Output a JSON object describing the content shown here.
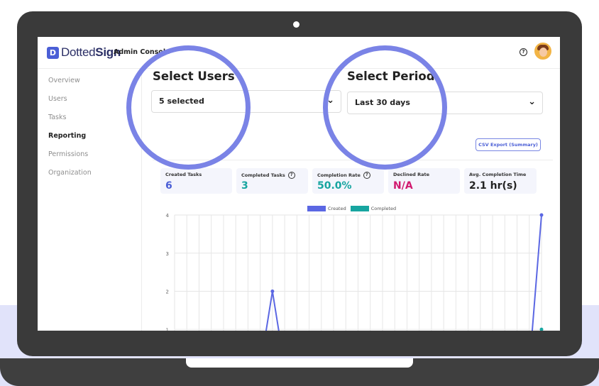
{
  "app": {
    "logo_mark": "D",
    "logo_text_light": "Dotted",
    "logo_text_bold": "Sign",
    "console_title": "Admin Console",
    "help_icon": "question-circle-icon",
    "avatar_icon": "user-avatar"
  },
  "sidebar": {
    "items": [
      {
        "label": "Overview",
        "active": false
      },
      {
        "label": "Users",
        "active": false
      },
      {
        "label": "Tasks",
        "active": false
      },
      {
        "label": "Reporting",
        "active": true
      },
      {
        "label": "Permissions",
        "active": false
      },
      {
        "label": "Organization",
        "active": false
      }
    ]
  },
  "filters": {
    "users_label": "Select Users",
    "users_value": "5 selected",
    "period_label": "Select Period",
    "period_value": "Last 30 days",
    "chevron_icon": "chevron-down-icon"
  },
  "csv_export_label": "CSV Export (Summary)",
  "stats": [
    {
      "label": "Created Tasks",
      "value": "6",
      "help": false,
      "color": "#4b5fd6"
    },
    {
      "label": "Completed Tasks",
      "value": "3",
      "help": true,
      "color": "#17a5a0"
    },
    {
      "label": "Completion Rate",
      "value": "50.0%",
      "help": true,
      "color": "#17a5a0"
    },
    {
      "label": "Declined Rate",
      "value": "N/A",
      "help": false,
      "color": "#d11a6f"
    },
    {
      "label": "Avg. Completion Time",
      "value": "2.1 hr(s)",
      "help": false,
      "color": "#222222"
    }
  ],
  "chart_data": {
    "type": "line",
    "yticks": [
      1,
      2,
      3,
      4
    ],
    "ylim": [
      0,
      4
    ],
    "x_count": 31,
    "series": [
      {
        "name": "Created",
        "color": "#5b67e3",
        "values": [
          0,
          0,
          0,
          0,
          0,
          0,
          0,
          0,
          2,
          0,
          0,
          0,
          0,
          0,
          0,
          0,
          0,
          0,
          0,
          0,
          0,
          0,
          0,
          0,
          0,
          0,
          0,
          0,
          0,
          0,
          4
        ]
      },
      {
        "name": "Completed",
        "color": "#17a5a0",
        "values": [
          0,
          0,
          0,
          0,
          0,
          0,
          0,
          0,
          0,
          0,
          0,
          0,
          0,
          0,
          0,
          0,
          0,
          0,
          0,
          0,
          0,
          0,
          0,
          0,
          0,
          0,
          0,
          0,
          0,
          0,
          1
        ]
      }
    ],
    "grid": true,
    "legend_position": "top-center"
  }
}
